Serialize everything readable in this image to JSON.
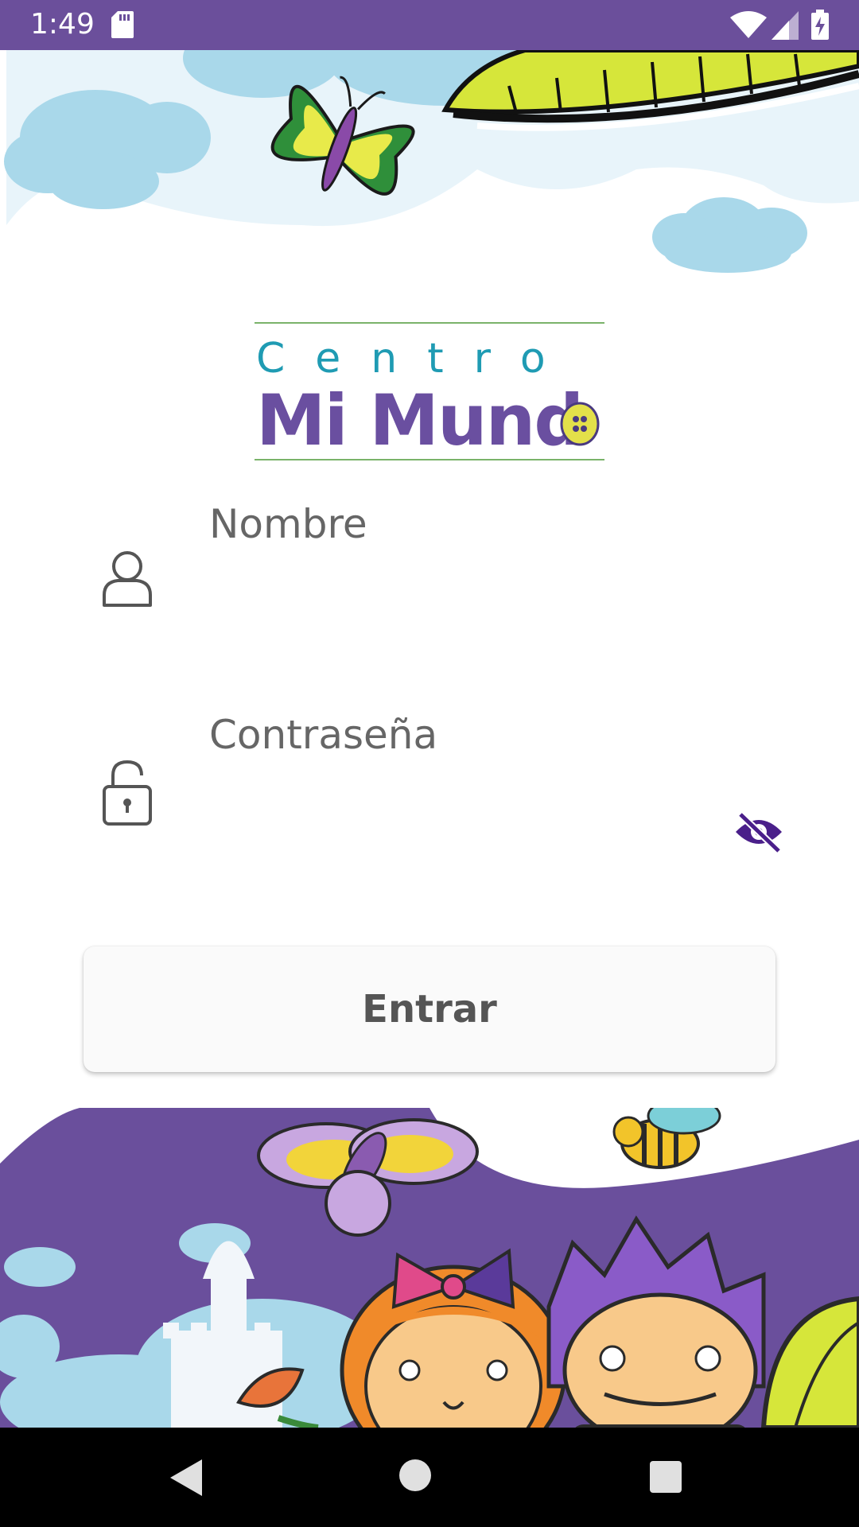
{
  "status_bar": {
    "time": "1:49",
    "icons": [
      "sd-card-icon",
      "wifi-icon",
      "cell-signal-icon",
      "battery-charging-icon"
    ],
    "background": "#6b4f9b"
  },
  "logo": {
    "line1": "Centro",
    "line2": "Mi Mund",
    "colors": {
      "centro": "#1f9bb3",
      "mimundo": "#6a4fa0",
      "button": "#e3e04a",
      "rule": "#7ab36a"
    }
  },
  "form": {
    "username": {
      "label": "Nombre",
      "value": "",
      "icon": "user-icon"
    },
    "password": {
      "label": "Contraseña",
      "value": "",
      "icon": "unlock-icon",
      "toggle_icon": "eye-off-icon"
    },
    "submit_label": "Entrar"
  },
  "colors": {
    "accent": "#6b4f9b",
    "eye_icon": "#4a1f8a",
    "label_text": "#666666"
  },
  "nav_bar": {
    "icons": [
      "back-icon",
      "home-icon",
      "recents-icon"
    ]
  }
}
